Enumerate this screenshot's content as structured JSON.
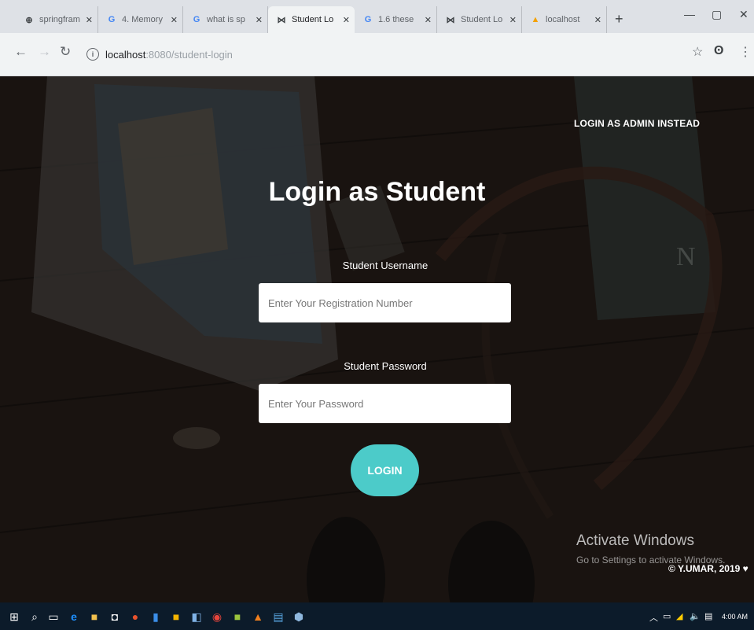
{
  "browser": {
    "tabs": [
      {
        "title": "springfram",
        "icon": "web-icon",
        "icon_color": "#5f6368"
      },
      {
        "title": "4. Memory",
        "icon": "google-icon",
        "icon_color": "#4285f4"
      },
      {
        "title": "what is sp",
        "icon": "google-icon",
        "icon_color": "#4285f4"
      },
      {
        "title": "Student Lo",
        "icon": "bowtie-icon",
        "icon_color": "#202124",
        "active": true
      },
      {
        "title": "1.6 these",
        "icon": "google-icon",
        "icon_color": "#4285f4"
      },
      {
        "title": "Student Lo",
        "icon": "bowtie-icon",
        "icon_color": "#202124"
      },
      {
        "title": "localhost",
        "icon": "tomcat-icon",
        "icon_color": "#f4a100"
      }
    ],
    "url_host": "localhost",
    "url_path": ":8080/student-login"
  },
  "page": {
    "admin_link": "LOGIN AS ADMIN INSTEAD",
    "heading": "Login as Student",
    "username_label": "Student Username",
    "username_placeholder": "Enter Your Registration Number",
    "password_label": "Student Password",
    "password_placeholder": "Enter Your Password",
    "login_button": "LOGIN",
    "copyright": "© Y.UMAR, 2019 ♥",
    "accent_color": "#4ccbc9"
  },
  "watermark": {
    "line1": "Activate Windows",
    "line2": "Go to Settings to activate Windows."
  },
  "taskbar": {
    "clock": "4:00 AM"
  }
}
